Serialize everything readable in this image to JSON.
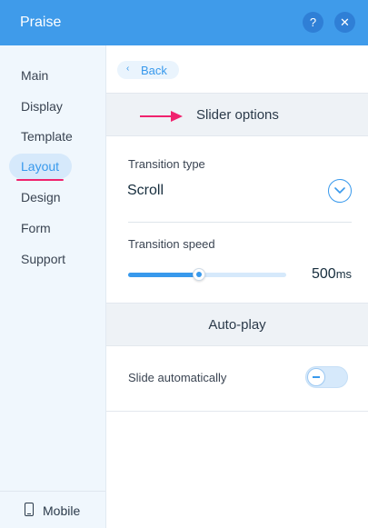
{
  "header": {
    "title": "Praise",
    "help_glyph": "?",
    "close_glyph": "✕"
  },
  "sidebar": {
    "items": [
      {
        "label": "Main"
      },
      {
        "label": "Display"
      },
      {
        "label": "Template"
      },
      {
        "label": "Layout"
      },
      {
        "label": "Design"
      },
      {
        "label": "Form"
      },
      {
        "label": "Support"
      }
    ],
    "active_item": "Layout",
    "bottom": {
      "label": "Mobile",
      "icon": "mobile-phone-icon"
    }
  },
  "main": {
    "back_label": "Back",
    "slider_section": {
      "title": "Slider options",
      "transition_type_label": "Transition type",
      "transition_type_value": "Scroll",
      "transition_speed_label": "Transition speed",
      "speed_value": "500",
      "speed_unit": "ms",
      "speed_slider_fraction": 0.45
    },
    "autoplay_section": {
      "title": "Auto-play",
      "slide_automatically_label": "Slide automatically",
      "slide_automatically_on": false
    }
  },
  "colors": {
    "header_bg": "#3f9bea",
    "accent": "#3899ec",
    "annotation": "#f0226e",
    "sidebar_bg": "#f0f7fd"
  }
}
